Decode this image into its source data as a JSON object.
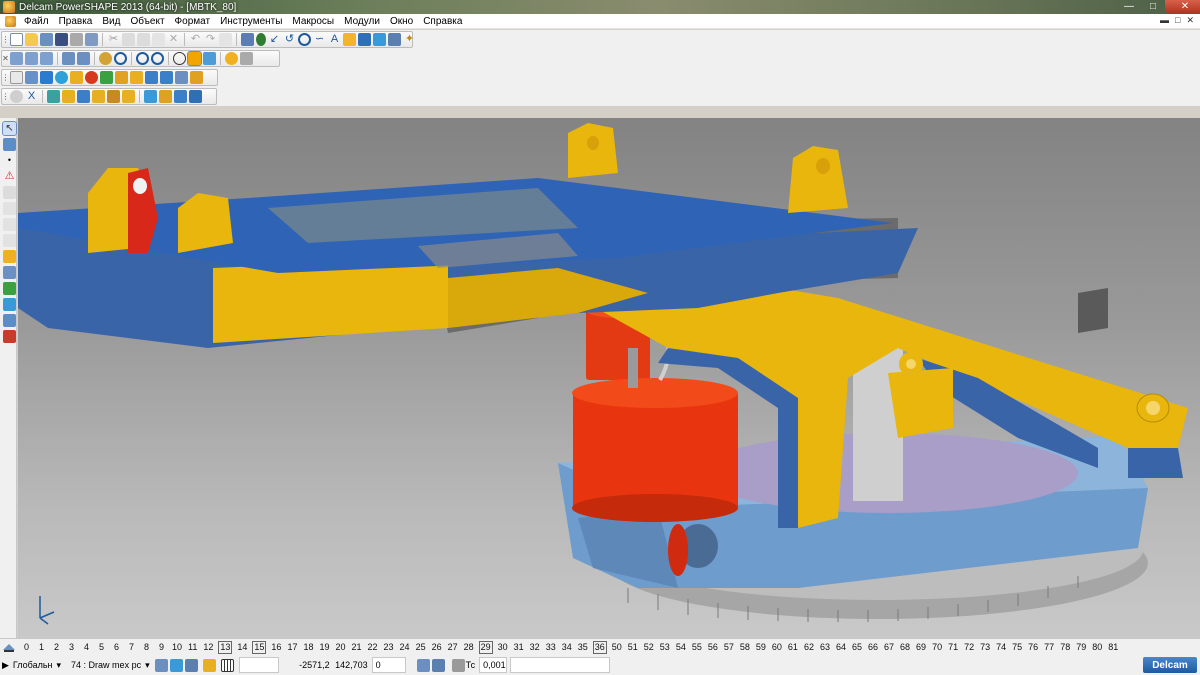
{
  "window": {
    "title": "Delcam PowerSHAPE 2013 (64-bit) - [MBTK_80]"
  },
  "menu": {
    "items": [
      "Файл",
      "Правка",
      "Вид",
      "Объект",
      "Формат",
      "Инструменты",
      "Макросы",
      "Модули",
      "Окно",
      "Справка"
    ]
  },
  "levels": {
    "numbers": [
      "0",
      "1",
      "2",
      "3",
      "4",
      "5",
      "6",
      "7",
      "8",
      "9",
      "10",
      "11",
      "12",
      "13",
      "14",
      "15",
      "16",
      "17",
      "18",
      "19",
      "20",
      "21",
      "22",
      "23",
      "24",
      "25",
      "26",
      "27",
      "28",
      "29",
      "30",
      "31",
      "32",
      "33",
      "34",
      "35",
      "36",
      "50",
      "51",
      "52",
      "53",
      "54",
      "55",
      "56",
      "57",
      "58",
      "59",
      "60",
      "61",
      "62",
      "63",
      "64",
      "65",
      "66",
      "67",
      "68",
      "69",
      "70",
      "71",
      "72",
      "73",
      "74",
      "75",
      "76",
      "77",
      "78",
      "79",
      "80",
      "81"
    ],
    "used": [
      "13",
      "15",
      "29",
      "36"
    ]
  },
  "status": {
    "workplane": "Глобальн",
    "level": "74  : Draw mex pc",
    "x": "-2571,2",
    "y": "142,703",
    "z": "0",
    "tolerance_label": "Тс",
    "tolerance": "0,001",
    "logo": "Delcam"
  },
  "colors": {
    "yellow": "#e8b60c",
    "blue": "#3a64a8",
    "lightblue": "#6f9fcf",
    "red": "#e83512",
    "grey": "#6c6c6c"
  }
}
